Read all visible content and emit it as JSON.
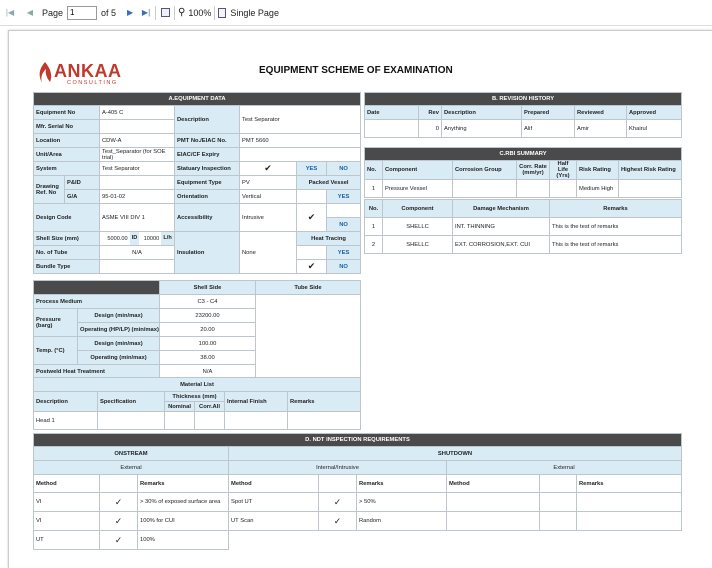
{
  "toolbar": {
    "page_label": "Page",
    "page_value": "1",
    "of_label": "of 5",
    "zoom": "100%",
    "view_mode": "Single Page"
  },
  "logo": {
    "name": "ANKAA",
    "sub": "CONSULTING",
    "brand_color": "#c0392b"
  },
  "title": "EQUIPMENT SCHEME OF EXAMINATION",
  "equip": {
    "header": "A.EQUIPMENT DATA",
    "equipment_no_l": "Equipment No",
    "equipment_no": "A-405 C",
    "mfr_l": "Mfr. Serial No",
    "description_l": "Description",
    "description": "Test Separator",
    "location_l": "Location",
    "location": "CDW-A",
    "pmt_l": "PMT No./EIAC No.",
    "pmt": "PMT 5660",
    "unit_l": "Unit/Area",
    "unit": "Test_Separator (for SOE trial)",
    "eiac_l": "EIAC/CF Expiry",
    "system_l": "System",
    "system": "Test Separator",
    "statuary_l": "Statuary Inspection",
    "yes": "YES",
    "no": "NO",
    "drawing_l": "Drawing Ref. No",
    "pid_l": "P&ID",
    "ga_l": "G/A",
    "ga": "95-01-02",
    "eqtype_l": "Equipment Type",
    "eqtype": "PV",
    "packed_l": "Packed Vessel",
    "orient_l": "Orientation",
    "orient": "Vertical",
    "design_code_l": "Design Code",
    "design_code": "ASME VIII DIV 1",
    "access_l": "Accessibility",
    "access": "Intrusive",
    "shell_l": "Shell Size (mm)",
    "shell_od": "5000.00",
    "id_l": "ID",
    "shell_id": "10000",
    "lh_l": "L/h",
    "heat_l": "Heat Tracing",
    "tube_no_l": "No. of Tube",
    "tube_no": "N/A",
    "insul_l": "Insulation",
    "insul": "None",
    "bundle_l": "Bundle Type"
  },
  "shell": {
    "shell_side": "Shell Side",
    "tube_side": "Tube Side",
    "process_l": "Process Medium",
    "process": "C3 - C4",
    "pressure_l": "Pressure (barg)",
    "design_l": "Design (min/max)",
    "pressure_design": "23200.00",
    "operating_hp_l": "Operating (HP/LP) (min/max)",
    "pressure_oper": "20.00",
    "temp_l": "Temp. (°C)",
    "temp_design": "100.00",
    "operating_l": "Operating (min/max)",
    "temp_oper": "38.00",
    "pwht_l": "Postweld Heat Treatment",
    "pwht": "N/A"
  },
  "material": {
    "header": "Material List",
    "desc_l": "Description",
    "spec_l": "Specification",
    "thick_l": "Thickness (mm)",
    "nominal_l": "Nominal",
    "corr_l": "Corr.All",
    "finish_l": "Internal Finish",
    "remarks_l": "Remarks",
    "row_desc": "Head 1"
  },
  "revision": {
    "header": "B. REVISION HISTORY",
    "cols": [
      "Date",
      "Rev",
      "Description",
      "Prepared",
      "Reviewed",
      "Approved"
    ],
    "row": [
      "",
      "0",
      "Anything",
      "Alif",
      "Amir",
      "Khairul"
    ]
  },
  "rbi": {
    "header": "C.RBI SUMMARY",
    "cols": [
      "No.",
      "Component",
      "Corrosion Group",
      "Corr. Rate (mm/yr)",
      "Half Life (Yrs)",
      "Risk Rating",
      "Highest Risk Rating"
    ],
    "row": [
      "1",
      "Pressure Vessel",
      "",
      "",
      "",
      "Medium High",
      ""
    ],
    "cols2": [
      "No.",
      "Component",
      "Damage Mechanism",
      "Remarks"
    ],
    "rows2": [
      [
        "1",
        "SHELLC",
        "INT. THINNING",
        "This is the test of remarks"
      ],
      [
        "2",
        "SHELLC",
        "EXT. CORROSION,EXT. CUI",
        "This is the test of remarks"
      ]
    ]
  },
  "ndt": {
    "header": "D. NDT INSPECTION REQUIREMENTS",
    "onstream": "ONSTREAM",
    "shutdown": "SHUTDOWN",
    "external": "External",
    "internal": "Internal/Intrusive",
    "method_l": "Method",
    "remarks_l": "Remarks",
    "rows": [
      {
        "m": "VI",
        "r": "> 30% of exposed surface area",
        "sm": "Spot UT",
        "sr": "> 50%"
      },
      {
        "m": "VI",
        "r": "100% for CUI",
        "sm": "UT Scan",
        "sr": "Random"
      },
      {
        "m": "UT",
        "r": "100%",
        "sm": "",
        "sr": ""
      }
    ]
  }
}
